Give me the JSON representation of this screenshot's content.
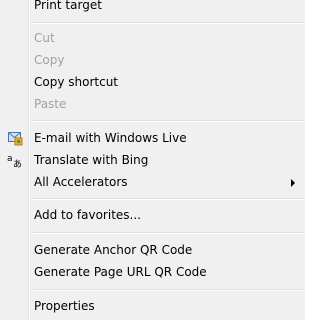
{
  "menu": {
    "items": [
      {
        "label": "Print target",
        "enabled": true
      },
      {
        "label": "Cut",
        "enabled": false
      },
      {
        "label": "Copy",
        "enabled": false
      },
      {
        "label": "Copy shortcut",
        "enabled": true
      },
      {
        "label": "Paste",
        "enabled": false
      },
      {
        "label": "E-mail with Windows Live",
        "enabled": true,
        "icon": "windows-live-mail-icon"
      },
      {
        "label": "Translate with Bing",
        "enabled": true,
        "icon": "translate-icon"
      },
      {
        "label": "All Accelerators",
        "enabled": true,
        "submenu": true,
        "icon": "submenu-arrow-icon"
      },
      {
        "label": "Add to favorites...",
        "enabled": true
      },
      {
        "label": "Generate Anchor QR Code",
        "enabled": true
      },
      {
        "label": "Generate Page URL QR Code",
        "enabled": true
      },
      {
        "label": "Properties",
        "enabled": true
      }
    ]
  },
  "colors": {
    "background": "#f0f0f0",
    "disabled_text": "#a0a0a0",
    "separator": "#e0e0e0"
  }
}
